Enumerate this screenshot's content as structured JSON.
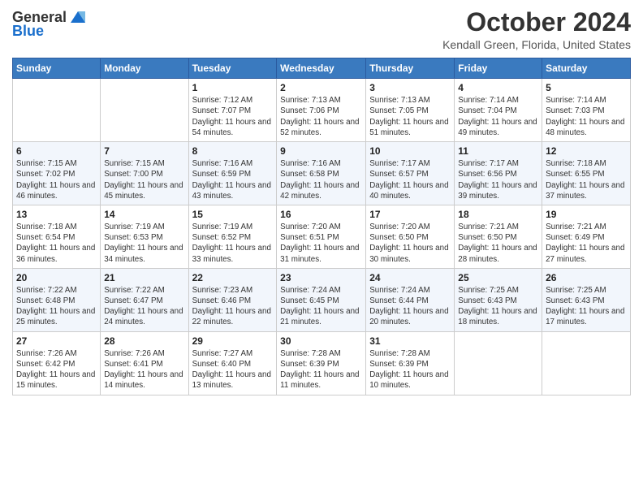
{
  "header": {
    "logo_general": "General",
    "logo_blue": "Blue",
    "month_title": "October 2024",
    "location": "Kendall Green, Florida, United States"
  },
  "days_of_week": [
    "Sunday",
    "Monday",
    "Tuesday",
    "Wednesday",
    "Thursday",
    "Friday",
    "Saturday"
  ],
  "weeks": [
    [
      {
        "num": "",
        "sunrise": "",
        "sunset": "",
        "daylight": ""
      },
      {
        "num": "",
        "sunrise": "",
        "sunset": "",
        "daylight": ""
      },
      {
        "num": "1",
        "sunrise": "Sunrise: 7:12 AM",
        "sunset": "Sunset: 7:07 PM",
        "daylight": "Daylight: 11 hours and 54 minutes."
      },
      {
        "num": "2",
        "sunrise": "Sunrise: 7:13 AM",
        "sunset": "Sunset: 7:06 PM",
        "daylight": "Daylight: 11 hours and 52 minutes."
      },
      {
        "num": "3",
        "sunrise": "Sunrise: 7:13 AM",
        "sunset": "Sunset: 7:05 PM",
        "daylight": "Daylight: 11 hours and 51 minutes."
      },
      {
        "num": "4",
        "sunrise": "Sunrise: 7:14 AM",
        "sunset": "Sunset: 7:04 PM",
        "daylight": "Daylight: 11 hours and 49 minutes."
      },
      {
        "num": "5",
        "sunrise": "Sunrise: 7:14 AM",
        "sunset": "Sunset: 7:03 PM",
        "daylight": "Daylight: 11 hours and 48 minutes."
      }
    ],
    [
      {
        "num": "6",
        "sunrise": "Sunrise: 7:15 AM",
        "sunset": "Sunset: 7:02 PM",
        "daylight": "Daylight: 11 hours and 46 minutes."
      },
      {
        "num": "7",
        "sunrise": "Sunrise: 7:15 AM",
        "sunset": "Sunset: 7:00 PM",
        "daylight": "Daylight: 11 hours and 45 minutes."
      },
      {
        "num": "8",
        "sunrise": "Sunrise: 7:16 AM",
        "sunset": "Sunset: 6:59 PM",
        "daylight": "Daylight: 11 hours and 43 minutes."
      },
      {
        "num": "9",
        "sunrise": "Sunrise: 7:16 AM",
        "sunset": "Sunset: 6:58 PM",
        "daylight": "Daylight: 11 hours and 42 minutes."
      },
      {
        "num": "10",
        "sunrise": "Sunrise: 7:17 AM",
        "sunset": "Sunset: 6:57 PM",
        "daylight": "Daylight: 11 hours and 40 minutes."
      },
      {
        "num": "11",
        "sunrise": "Sunrise: 7:17 AM",
        "sunset": "Sunset: 6:56 PM",
        "daylight": "Daylight: 11 hours and 39 minutes."
      },
      {
        "num": "12",
        "sunrise": "Sunrise: 7:18 AM",
        "sunset": "Sunset: 6:55 PM",
        "daylight": "Daylight: 11 hours and 37 minutes."
      }
    ],
    [
      {
        "num": "13",
        "sunrise": "Sunrise: 7:18 AM",
        "sunset": "Sunset: 6:54 PM",
        "daylight": "Daylight: 11 hours and 36 minutes."
      },
      {
        "num": "14",
        "sunrise": "Sunrise: 7:19 AM",
        "sunset": "Sunset: 6:53 PM",
        "daylight": "Daylight: 11 hours and 34 minutes."
      },
      {
        "num": "15",
        "sunrise": "Sunrise: 7:19 AM",
        "sunset": "Sunset: 6:52 PM",
        "daylight": "Daylight: 11 hours and 33 minutes."
      },
      {
        "num": "16",
        "sunrise": "Sunrise: 7:20 AM",
        "sunset": "Sunset: 6:51 PM",
        "daylight": "Daylight: 11 hours and 31 minutes."
      },
      {
        "num": "17",
        "sunrise": "Sunrise: 7:20 AM",
        "sunset": "Sunset: 6:50 PM",
        "daylight": "Daylight: 11 hours and 30 minutes."
      },
      {
        "num": "18",
        "sunrise": "Sunrise: 7:21 AM",
        "sunset": "Sunset: 6:50 PM",
        "daylight": "Daylight: 11 hours and 28 minutes."
      },
      {
        "num": "19",
        "sunrise": "Sunrise: 7:21 AM",
        "sunset": "Sunset: 6:49 PM",
        "daylight": "Daylight: 11 hours and 27 minutes."
      }
    ],
    [
      {
        "num": "20",
        "sunrise": "Sunrise: 7:22 AM",
        "sunset": "Sunset: 6:48 PM",
        "daylight": "Daylight: 11 hours and 25 minutes."
      },
      {
        "num": "21",
        "sunrise": "Sunrise: 7:22 AM",
        "sunset": "Sunset: 6:47 PM",
        "daylight": "Daylight: 11 hours and 24 minutes."
      },
      {
        "num": "22",
        "sunrise": "Sunrise: 7:23 AM",
        "sunset": "Sunset: 6:46 PM",
        "daylight": "Daylight: 11 hours and 22 minutes."
      },
      {
        "num": "23",
        "sunrise": "Sunrise: 7:24 AM",
        "sunset": "Sunset: 6:45 PM",
        "daylight": "Daylight: 11 hours and 21 minutes."
      },
      {
        "num": "24",
        "sunrise": "Sunrise: 7:24 AM",
        "sunset": "Sunset: 6:44 PM",
        "daylight": "Daylight: 11 hours and 20 minutes."
      },
      {
        "num": "25",
        "sunrise": "Sunrise: 7:25 AM",
        "sunset": "Sunset: 6:43 PM",
        "daylight": "Daylight: 11 hours and 18 minutes."
      },
      {
        "num": "26",
        "sunrise": "Sunrise: 7:25 AM",
        "sunset": "Sunset: 6:43 PM",
        "daylight": "Daylight: 11 hours and 17 minutes."
      }
    ],
    [
      {
        "num": "27",
        "sunrise": "Sunrise: 7:26 AM",
        "sunset": "Sunset: 6:42 PM",
        "daylight": "Daylight: 11 hours and 15 minutes."
      },
      {
        "num": "28",
        "sunrise": "Sunrise: 7:26 AM",
        "sunset": "Sunset: 6:41 PM",
        "daylight": "Daylight: 11 hours and 14 minutes."
      },
      {
        "num": "29",
        "sunrise": "Sunrise: 7:27 AM",
        "sunset": "Sunset: 6:40 PM",
        "daylight": "Daylight: 11 hours and 13 minutes."
      },
      {
        "num": "30",
        "sunrise": "Sunrise: 7:28 AM",
        "sunset": "Sunset: 6:39 PM",
        "daylight": "Daylight: 11 hours and 11 minutes."
      },
      {
        "num": "31",
        "sunrise": "Sunrise: 7:28 AM",
        "sunset": "Sunset: 6:39 PM",
        "daylight": "Daylight: 11 hours and 10 minutes."
      },
      {
        "num": "",
        "sunrise": "",
        "sunset": "",
        "daylight": ""
      },
      {
        "num": "",
        "sunrise": "",
        "sunset": "",
        "daylight": ""
      }
    ]
  ]
}
